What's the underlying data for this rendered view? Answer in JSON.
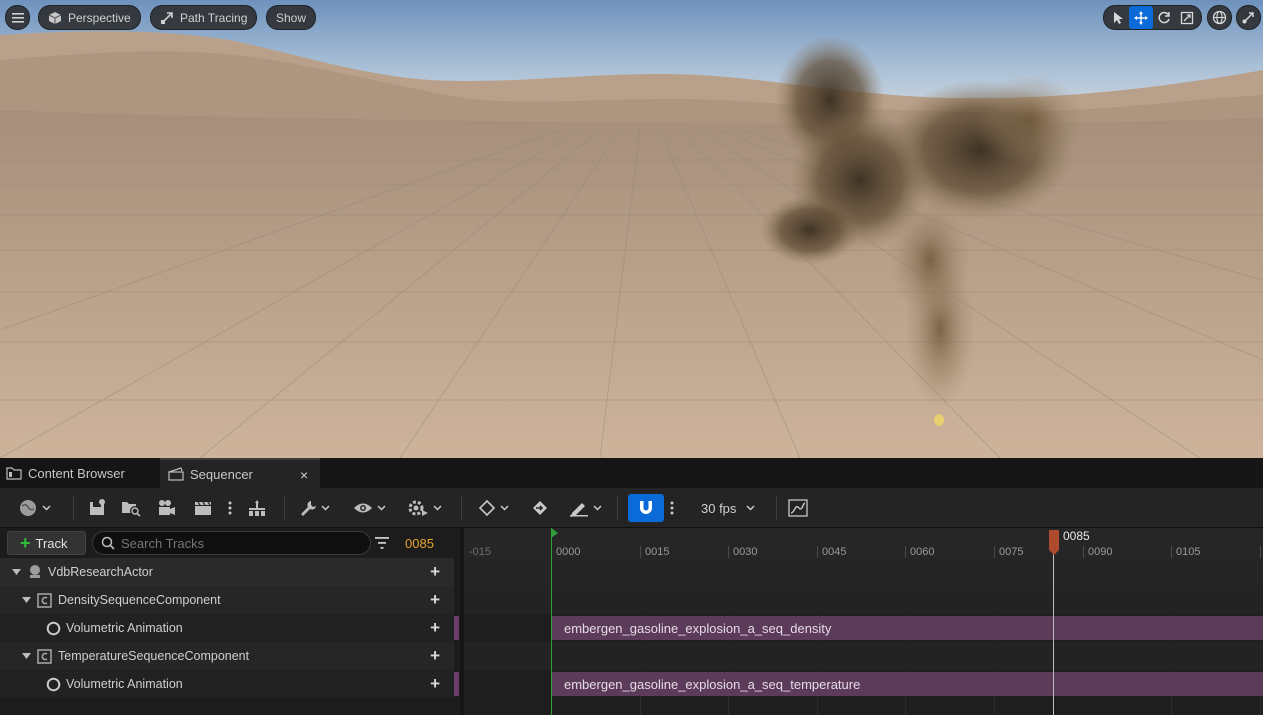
{
  "viewport": {
    "menu_icon": "hamburger-icon",
    "perspective_label": "Perspective",
    "path_tracing_label": "Path Tracing",
    "show_label": "Show",
    "tools": [
      "select-icon",
      "translate-icon",
      "rotate-icon",
      "scale-icon"
    ],
    "world_icon": "globe-icon",
    "snap_icon": "transform-snap-icon"
  },
  "tabs": [
    {
      "label": "Content Browser",
      "icon": "content-browser-icon"
    },
    {
      "label": "Sequencer",
      "icon": "clapper-icon",
      "close": "×"
    }
  ],
  "toolbar": {
    "fps_label": "30 fps",
    "accent": "#0a6ad8"
  },
  "outliner": {
    "add_track_label": "Track",
    "search_placeholder": "Search Tracks",
    "current_frame": "0085",
    "rows": [
      {
        "label": "VdbResearchActor"
      },
      {
        "label": "DensitySequenceComponent"
      },
      {
        "label": "Volumetric Animation"
      },
      {
        "label": "TemperatureSequenceComponent"
      },
      {
        "label": "Volumetric Animation"
      }
    ]
  },
  "timeline": {
    "ticks": [
      "-015",
      "0000",
      "0015",
      "0030",
      "0045",
      "0060",
      "0075",
      "0090",
      "0105"
    ],
    "playhead_label": "0085",
    "sections": [
      "embergen_gasoline_explosion_a_seq_density",
      "embergen_gasoline_explosion_a_seq_temperature"
    ],
    "section_color": "#5b3a5a"
  }
}
